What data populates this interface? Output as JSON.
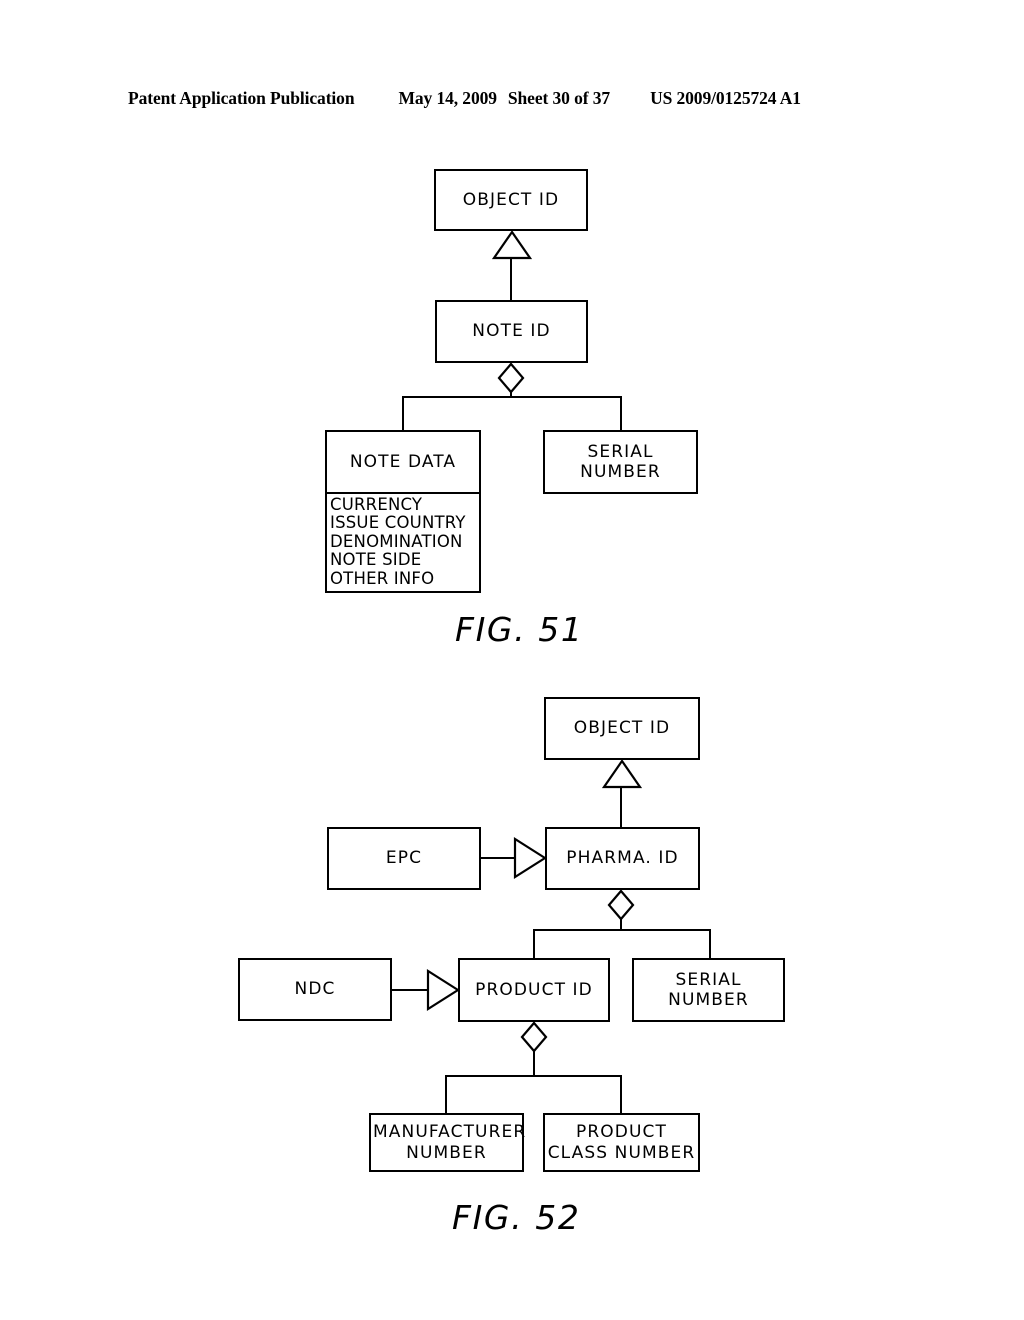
{
  "header": {
    "publication": "Patent Application Publication",
    "date": "May 14, 2009",
    "sheet": "Sheet 30 of 37",
    "patent_number": "US 2009/0125724 A1"
  },
  "figures": [
    {
      "id": "fig-51",
      "caption": "FIG. 51",
      "nodes": {
        "object_id": "OBJECT ID",
        "note_id": "NOTE ID",
        "note_data": "NOTE DATA",
        "note_data_attributes": [
          "CURRENCY",
          "ISSUE COUNTRY",
          "DENOMINATION",
          "NOTE SIDE",
          "OTHER INFO"
        ],
        "serial_number": "SERIAL\nNUMBER"
      }
    },
    {
      "id": "fig-52",
      "caption": "FIG. 52",
      "nodes": {
        "object_id": "OBJECT ID",
        "epc": "EPC",
        "pharma_id": "PHARMA. ID",
        "ndc": "NDC",
        "product_id": "PRODUCT ID",
        "serial_number": "SERIAL\nNUMBER",
        "manufacturer_number": "MANUFACTURER\nNUMBER",
        "product_class_number": "PRODUCT\nCLASS NUMBER"
      }
    }
  ],
  "colors": {
    "ink": "#000000",
    "paper": "#ffffff"
  }
}
